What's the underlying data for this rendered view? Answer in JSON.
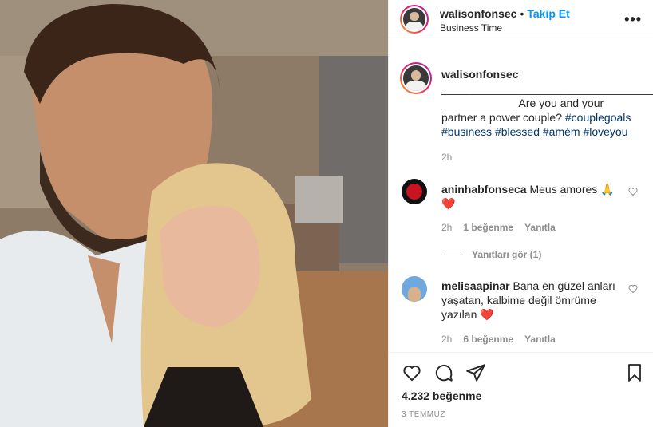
{
  "post": {
    "username": "walisonfonsec",
    "follow_label": "Takip Et",
    "separator": "•",
    "location": "Business Time",
    "more_label": "•••"
  },
  "caption": {
    "username": "walisonfonsec",
    "line1": "___________________________________",
    "line2_prefix": "____________ Are you and your",
    "line3_text": "partner a power couple? ",
    "hashtags": [
      "#couplegoals",
      "#business",
      "#blessed",
      "#amém",
      "#loveyou"
    ],
    "time": "2h"
  },
  "comments": [
    {
      "username": "aninhabfonseca",
      "text": "Meus amores 🙏",
      "emoji2": "❤️",
      "time": "2h",
      "likes": "1 beğenme",
      "reply": "Yanıtla",
      "view_replies": "Yanıtları gör (1)"
    },
    {
      "username": "melisaapinar",
      "text_l1": "Bana en güzel anları",
      "text_l2": "yaşatan, kalbime değil ömrüme",
      "text_l3": "yazılan",
      "emoji": "❤️",
      "time": "2h",
      "likes": "6 beğenme",
      "reply": "Yanıtla"
    }
  ],
  "footer": {
    "likes": "4.232 beğenme",
    "date": "3 TEMMUZ"
  },
  "icons": [
    "heart-icon",
    "comment-icon",
    "share-icon",
    "bookmark-icon",
    "like-comment-icon",
    "more-options-icon"
  ],
  "colors": {
    "accent": "#0095f6",
    "hashtag": "#00376b",
    "muted": "#8e8e8e",
    "heart_red": "#ed4956"
  }
}
